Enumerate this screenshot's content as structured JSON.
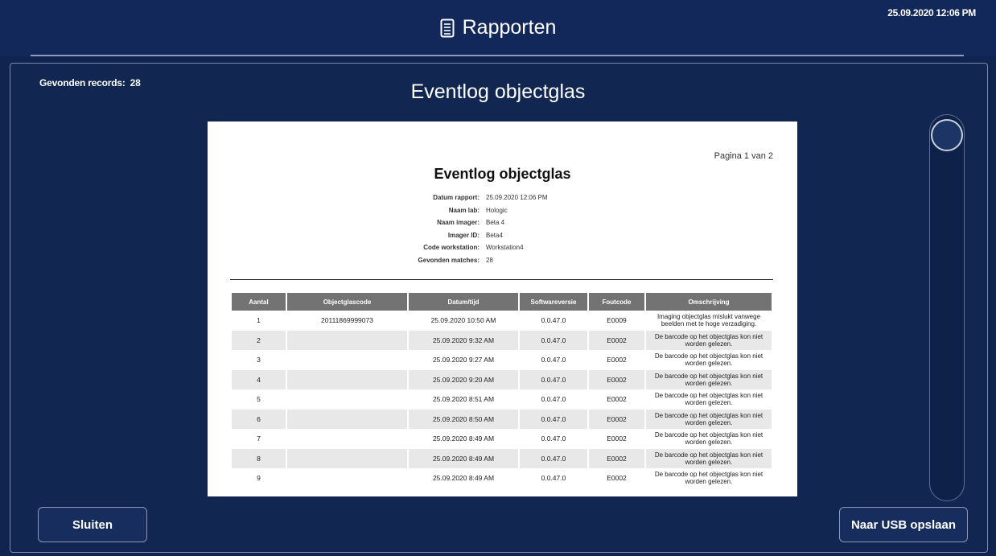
{
  "header": {
    "title": "Rapporten",
    "title_icon": "document-icon",
    "datetime": "25.09.2020 12:06 PM"
  },
  "main": {
    "records_label": "Gevonden records:",
    "records_count": "28",
    "heading": "Eventlog objectglas"
  },
  "report": {
    "page_indicator": "Pagina 1 van 2",
    "title": "Eventlog objectglas",
    "meta": [
      {
        "key": "Datum rapport:",
        "value": "25.09.2020 12:06 PM"
      },
      {
        "key": "Naam lab:",
        "value": "Hologic"
      },
      {
        "key": "Naam imager:",
        "value": "Beta 4"
      },
      {
        "key": "Imager ID:",
        "value": "Beta4"
      },
      {
        "key": "Code workstation:",
        "value": "Workstation4"
      },
      {
        "key": "Gevonden matches:",
        "value": "28"
      }
    ],
    "columns": [
      "Aantal",
      "Objectglascode",
      "Datum/tijd",
      "Softwareversie",
      "Foutcode",
      "Omschrijving"
    ],
    "rows": [
      [
        "1",
        "20111869999073",
        "25.09.2020 10:50 AM",
        "0.0.47.0",
        "E0009",
        "Imaging objectglas mislukt vanwege beelden met te hoge verzadiging."
      ],
      [
        "2",
        "",
        "25.09.2020 9:32 AM",
        "0.0.47.0",
        "E0002",
        "De barcode op het objectglas kon niet worden gelezen."
      ],
      [
        "3",
        "",
        "25.09.2020 9:27 AM",
        "0.0.47.0",
        "E0002",
        "De barcode op het objectglas kon niet worden gelezen."
      ],
      [
        "4",
        "",
        "25.09.2020 9:20 AM",
        "0.0.47.0",
        "E0002",
        "De barcode op het objectglas kon niet worden gelezen."
      ],
      [
        "5",
        "",
        "25.09.2020 8:51 AM",
        "0.0.47.0",
        "E0002",
        "De barcode op het objectglas kon niet worden gelezen."
      ],
      [
        "6",
        "",
        "25.09.2020 8:50 AM",
        "0.0.47.0",
        "E0002",
        "De barcode op het objectglas kon niet worden gelezen."
      ],
      [
        "7",
        "",
        "25.09.2020 8:49 AM",
        "0.0.47.0",
        "E0002",
        "De barcode op het objectglas kon niet worden gelezen."
      ],
      [
        "8",
        "",
        "25.09.2020 8:49 AM",
        "0.0.47.0",
        "E0002",
        "De barcode op het objectglas kon niet worden gelezen."
      ],
      [
        "9",
        "",
        "25.09.2020 8:49 AM",
        "0.0.47.0",
        "E0002",
        "De barcode op het objectglas kon niet worden gelezen."
      ]
    ]
  },
  "scrollbar": {
    "position": 0
  },
  "footer": {
    "close_label": "Sluiten",
    "usb_label": "Naar USB opslaan"
  }
}
